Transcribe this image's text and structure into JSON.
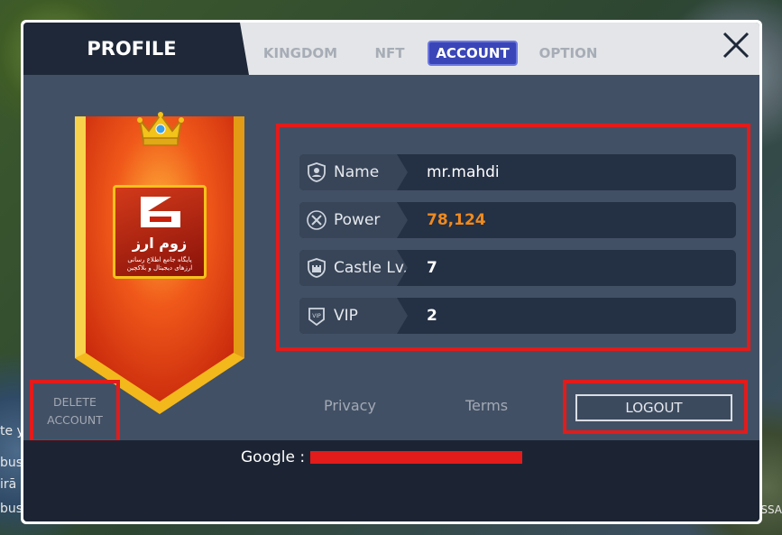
{
  "background": {
    "left_snippets": [
      "te y",
      "bus",
      "irā",
      "bus"
    ],
    "right_snippet": "ESSA"
  },
  "header": {
    "profile_title": "PROFILE",
    "tabs": [
      {
        "label": "KINGDOM",
        "active": false
      },
      {
        "label": "NFT",
        "active": false
      },
      {
        "label": "ACCOUNT",
        "active": true
      },
      {
        "label": "OPTION",
        "active": false
      }
    ],
    "close_glyph": "✕"
  },
  "banner": {
    "logo_title": "زوم ارز",
    "logo_subtitle": "پایگاه جامع اطلاع رسانی ارزهای دیجیتال و بلاکچین"
  },
  "profile": {
    "rows": [
      {
        "label": "Name",
        "value": "mr.mahdi",
        "icon": "person-shield-icon"
      },
      {
        "label": "Power",
        "value": "78,124",
        "icon": "crossed-swords-icon"
      },
      {
        "label": "Castle Lv.",
        "value": "7",
        "icon": "castle-icon"
      },
      {
        "label": "VIP",
        "value": "2",
        "icon": "vip-badge-icon"
      }
    ]
  },
  "actions": {
    "delete_line1": "DELETE",
    "delete_line2": "ACCOUNT",
    "privacy": "Privacy",
    "terms": "Terms",
    "logout": "LOGOUT"
  },
  "footer": {
    "google_label": "Google :"
  },
  "colors": {
    "highlight": "#e21b1b",
    "power_accent": "#f08a1e",
    "active_tab": "#3a46b8"
  }
}
